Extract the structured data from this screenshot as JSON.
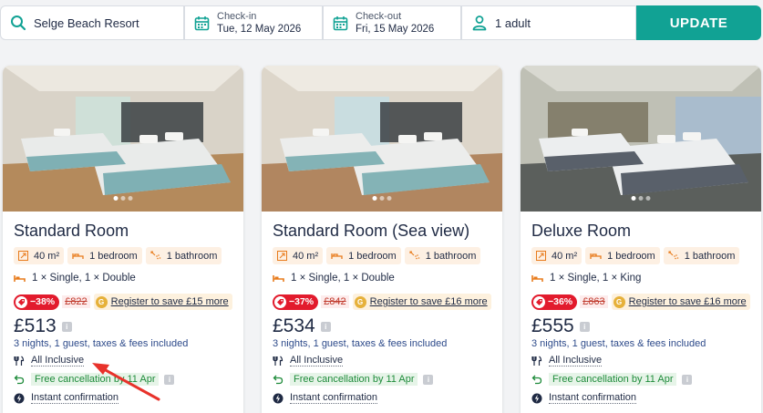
{
  "search": {
    "destination": "Selge Beach Resort",
    "checkin_label": "Check-in",
    "checkin_value": "Tue, 12 May 2026",
    "checkout_label": "Check-out",
    "checkout_value": "Fri, 15 May 2026",
    "guests": "1 adult",
    "update_label": "UPDATE"
  },
  "colors": {
    "accent": "#11a294",
    "discount": "#e21b2d",
    "chip": "#fdf0e3",
    "cancel_green": "#1e8b3a",
    "arrow": "#e8322b"
  },
  "rooms": [
    {
      "title": "Standard Room",
      "size": "40 m²",
      "bedrooms": "1 bedroom",
      "bathrooms": "1 bathroom",
      "beds": "1 × Single, 1 × Double",
      "discount": "−38%",
      "old_price": "£822",
      "register": "Register to save £15 more",
      "price": "£513",
      "nights": "3 nights, 1 guest, taxes & fees included",
      "board": "All Inclusive",
      "cancellation": "Free cancellation by 11 Apr",
      "confirmation": "Instant confirmation"
    },
    {
      "title": "Standard Room (Sea view)",
      "size": "40 m²",
      "bedrooms": "1 bedroom",
      "bathrooms": "1 bathroom",
      "beds": "1 × Single, 1 × Double",
      "discount": "−37%",
      "old_price": "£842",
      "register": "Register to save £16 more",
      "price": "£534",
      "nights": "3 nights, 1 guest, taxes & fees included",
      "board": "All Inclusive",
      "cancellation": "Free cancellation by 11 Apr",
      "confirmation": "Instant confirmation"
    },
    {
      "title": "Deluxe Room",
      "size": "40 m²",
      "bedrooms": "1 bedroom",
      "bathrooms": "1 bathroom",
      "beds": "1 × Single, 1 × King",
      "discount": "−36%",
      "old_price": "£863",
      "register": "Register to save £16 more",
      "price": "£555",
      "nights": "3 nights, 1 guest, taxes & fees included",
      "board": "All Inclusive",
      "cancellation": "Free cancellation by 11 Apr",
      "confirmation": "Instant confirmation"
    }
  ],
  "photo_icon": "room-photo",
  "annotation": "red-arrow-pointing-to-all-inclusive"
}
